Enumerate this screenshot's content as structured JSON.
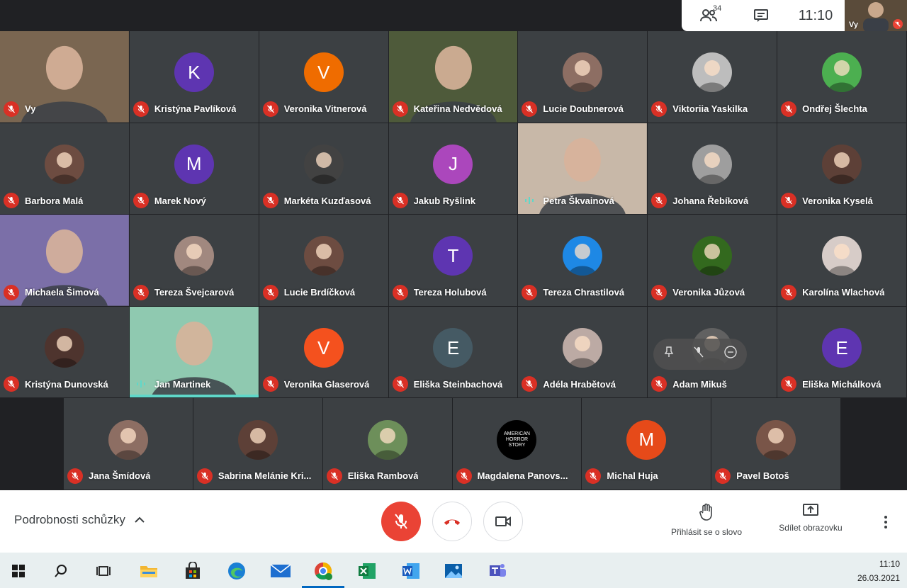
{
  "topbar": {
    "participant_count": "34",
    "clock": "11:10",
    "self_label": "Vy"
  },
  "tiles": [
    {
      "name": "Vy",
      "col": 0,
      "row": 0,
      "kind": "photo",
      "photo": "#7a6651"
    },
    {
      "name": "Kristýna Pavlíková",
      "col": 1,
      "row": 0,
      "kind": "letter",
      "letter": "K",
      "color": "#5e35b1"
    },
    {
      "name": "Veronika Vitnerová",
      "col": 2,
      "row": 0,
      "kind": "letter",
      "letter": "V",
      "color": "#ef6c00"
    },
    {
      "name": "Kateřina Nedvědová",
      "col": 3,
      "row": 0,
      "kind": "photo",
      "photo": "#4e5a3a"
    },
    {
      "name": "Lucie Doubnerová",
      "col": 4,
      "row": 0,
      "kind": "avatar",
      "color": "#8d6e63"
    },
    {
      "name": "Viktoriia Yaskilka",
      "col": 5,
      "row": 0,
      "kind": "avatar",
      "color": "#bdbdbd"
    },
    {
      "name": "Ondřej Šlechta",
      "col": 6,
      "row": 0,
      "kind": "avatar",
      "color": "#4caf50"
    },
    {
      "name": "Barbora Malá",
      "col": 0,
      "row": 1,
      "kind": "avatar",
      "color": "#6d4c41"
    },
    {
      "name": "Marek Nový",
      "col": 1,
      "row": 1,
      "kind": "letter",
      "letter": "M",
      "color": "#5e35b1"
    },
    {
      "name": "Markéta Kuzďasová",
      "col": 2,
      "row": 1,
      "kind": "avatar",
      "color": "#424242"
    },
    {
      "name": "Jakub Ryšlink",
      "col": 3,
      "row": 1,
      "kind": "letter",
      "letter": "J",
      "color": "#ab47bc"
    },
    {
      "name": "Petra Škvainová",
      "col": 4,
      "row": 1,
      "kind": "photo",
      "photo": "#c8b8a8",
      "speaking": true
    },
    {
      "name": "Johana Řebíková",
      "col": 5,
      "row": 1,
      "kind": "avatar",
      "color": "#9e9e9e"
    },
    {
      "name": "Veronika Kyselá",
      "col": 6,
      "row": 1,
      "kind": "avatar",
      "color": "#5d4037"
    },
    {
      "name": "Michaela Šimová",
      "col": 0,
      "row": 2,
      "kind": "photo",
      "photo": "#7b6fa8"
    },
    {
      "name": "Tereza Švejcarová",
      "col": 1,
      "row": 2,
      "kind": "avatar",
      "color": "#a1887f"
    },
    {
      "name": "Lucie Brdíčková",
      "col": 2,
      "row": 2,
      "kind": "avatar",
      "color": "#6d4c41"
    },
    {
      "name": "Tereza Holubová",
      "col": 3,
      "row": 2,
      "kind": "letter",
      "letter": "T",
      "color": "#5e35b1"
    },
    {
      "name": "Tereza Chrastilová",
      "col": 4,
      "row": 2,
      "kind": "avatar",
      "color": "#1e88e5"
    },
    {
      "name": "Veronika Jůzová",
      "col": 5,
      "row": 2,
      "kind": "avatar",
      "color": "#33691e"
    },
    {
      "name": "Karolína Wlachová",
      "col": 6,
      "row": 2,
      "kind": "avatar",
      "color": "#d7ccc8"
    },
    {
      "name": "Kristýna Dunovská",
      "col": 0,
      "row": 3,
      "kind": "avatar",
      "color": "#4e342e"
    },
    {
      "name": "Jan Martinek",
      "col": 1,
      "row": 3,
      "kind": "photo",
      "photo": "#8fc9b0",
      "speaking": true,
      "speakline": true
    },
    {
      "name": "Veronika Glaserová",
      "col": 2,
      "row": 3,
      "kind": "letter",
      "letter": "V",
      "color": "#f4511e"
    },
    {
      "name": "Eliška Steinbachová",
      "col": 3,
      "row": 3,
      "kind": "letter",
      "letter": "E",
      "color": "#455a64"
    },
    {
      "name": "Adéla Hrabětová",
      "col": 4,
      "row": 3,
      "kind": "avatar",
      "color": "#bcaaa4"
    },
    {
      "name": "Adam Mikuš",
      "col": 5,
      "row": 3,
      "kind": "avatar",
      "color": "#616161",
      "hover": true
    },
    {
      "name": "Eliška Michálková",
      "col": 6,
      "row": 3,
      "kind": "letter",
      "letter": "E",
      "color": "#5e35b1"
    },
    {
      "name": "Jana Šmídová",
      "col": 0,
      "row": 4,
      "kind": "avatar",
      "color": "#8d6e63"
    },
    {
      "name": "Sabrina Melánie Kri...",
      "col": 1,
      "row": 4,
      "kind": "avatar",
      "color": "#5d4037"
    },
    {
      "name": "Eliška Rambová",
      "col": 2,
      "row": 4,
      "kind": "avatar",
      "color": "#6d8f5a"
    },
    {
      "name": "Magdalena Panovs...",
      "col": 3,
      "row": 4,
      "kind": "avatar",
      "color": "#000000",
      "avatar_text": "AMERICAN HORROR STORY"
    },
    {
      "name": "Michal Huja",
      "col": 4,
      "row": 4,
      "kind": "letter",
      "letter": "M",
      "color": "#e64a19"
    },
    {
      "name": "Pavel Botoš",
      "col": 5,
      "row": 4,
      "kind": "avatar",
      "color": "#795548"
    }
  ],
  "bottombar": {
    "details_label": "Podrobnosti schůzky",
    "raise_hand_label": "Přihlásit se o slovo",
    "share_label": "Sdílet obrazovku"
  },
  "taskbar": {
    "time": "11:10",
    "date": "26.03.2021"
  }
}
